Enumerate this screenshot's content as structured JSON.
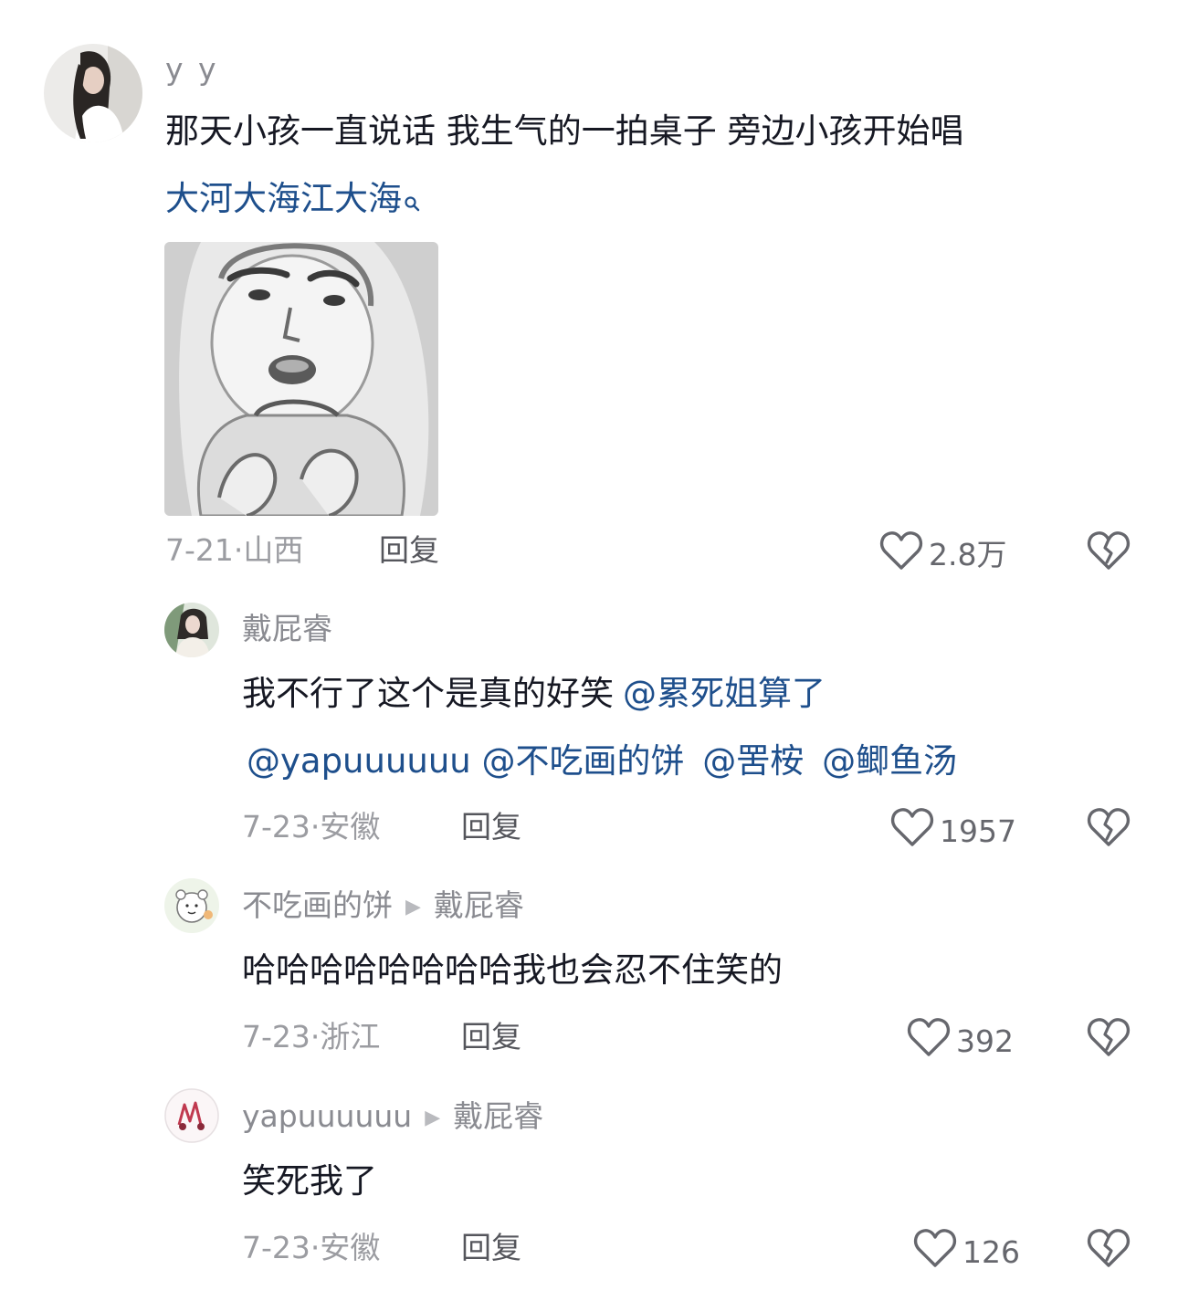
{
  "comments": [
    {
      "author": "y y",
      "text": "那天小孩一直说话 我生气的一拍桌子 旁边小孩开始唱",
      "link": "大河大海江大海",
      "date": "7-21",
      "region": "山西",
      "reply_label": "回复",
      "likes": "2.8万"
    }
  ],
  "replies": [
    {
      "author": "戴屁睿",
      "text": "我不行了这个是真的好笑",
      "mentions_line1": "@累死姐算了",
      "mentions_line2": [
        "@yapuuuuuu",
        "@不吃画的饼",
        "@罟桉",
        "@鲫鱼汤"
      ],
      "date": "7-23",
      "region": "安徽",
      "reply_label": "回复",
      "likes": "1957"
    },
    {
      "author": "不吃画的饼",
      "reply_to": "戴屁睿",
      "text": "哈哈哈哈哈哈哈哈我也会忍不住笑的",
      "date": "7-23",
      "region": "浙江",
      "reply_label": "回复",
      "likes": "392"
    },
    {
      "author": "yapuuuuuu",
      "reply_to": "戴屁睿",
      "text": "笑死我了",
      "date": "7-23",
      "region": "安徽",
      "reply_label": "回复",
      "likes": "126"
    }
  ],
  "icons": {
    "like": "heart-outline-icon",
    "dislike": "broken-heart-icon",
    "search": "search-icon",
    "reply_arrow": "triangle-right-icon"
  },
  "colors": {
    "mention": "#1e4f8c",
    "meta": "#9b9ca1",
    "text": "#161823"
  }
}
